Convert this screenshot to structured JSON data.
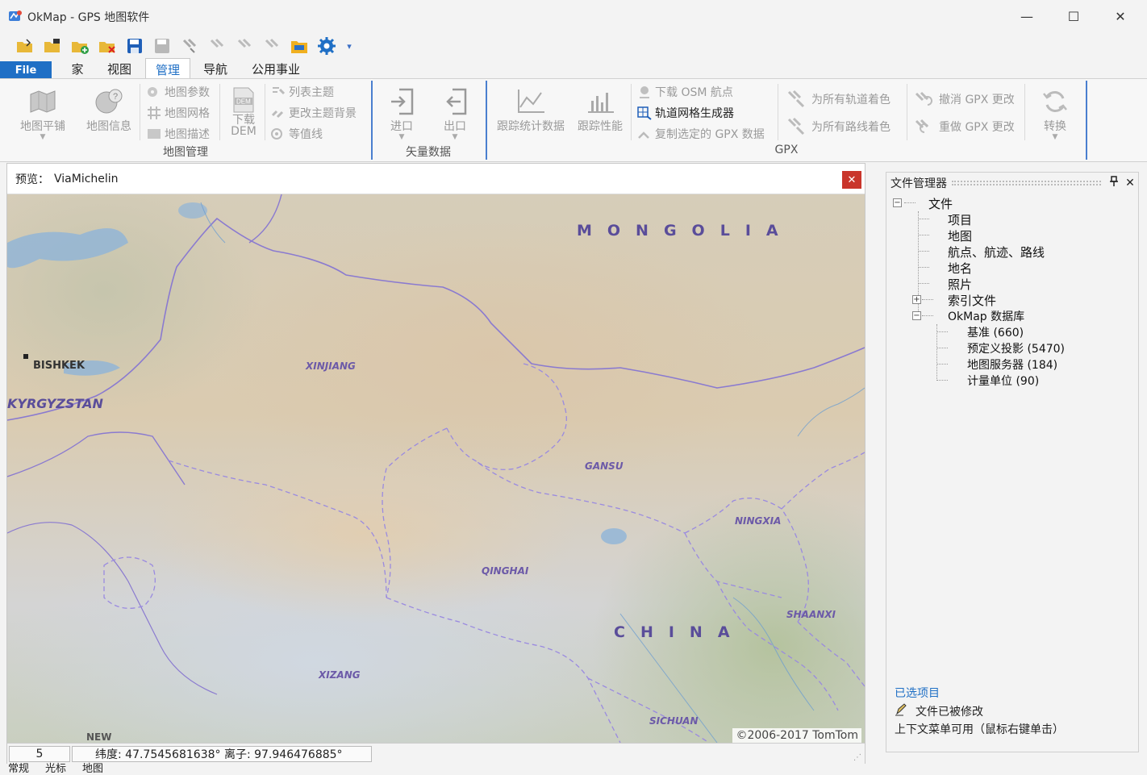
{
  "window": {
    "title": "OkMap - GPS 地图软件",
    "minimize": "—",
    "maximize": "☐",
    "close": "✕"
  },
  "qat": {
    "icons": [
      "open-folder-icon",
      "open-folder-icon",
      "add-folder-icon",
      "close-folder-icon",
      "save-icon",
      "save-disabled-icon",
      "download-disabled-icon",
      "upload-disabled-icon",
      "export-disabled-icon",
      "import-disabled-icon",
      "folder-icon",
      "settings-icon"
    ],
    "more": "▾"
  },
  "tabs": {
    "file": "File",
    "home": "家",
    "view": "视图",
    "manage": "管理",
    "navigate": "导航",
    "utilities": "公用事业"
  },
  "ribbon": {
    "map_tile": "地图平铺",
    "map_info": "地图信息",
    "map_params": "地图参数",
    "map_grid": "地图网格",
    "map_desc": "地图描述",
    "dem_badge": "DEM",
    "download_dem_1": "下载",
    "download_dem_2": "DEM",
    "list_theme": "列表主题",
    "change_theme_bg": "更改主题背景",
    "contour": "等值线",
    "group_map_manage": "地图管理",
    "import": "进口",
    "export": "出口",
    "group_vector": "矢量数据",
    "track_stats": "跟踪统计数据",
    "track_perf": "跟踪性能",
    "download_osm": "下载 OSM 航点",
    "track_grid": "轨道网格生成器",
    "copy_gpx": "复制选定的 GPX 数据",
    "color_tracks": "为所有轨道着色",
    "color_routes": "为所有路线着色",
    "undo_gpx": "撤消 GPX 更改",
    "redo_gpx": "重做 GPX 更改",
    "convert": "转换",
    "group_gpx": "GPX"
  },
  "preview": {
    "label": "预览：",
    "source": "ViaMichelin",
    "close": "✕",
    "copyright": "©2006-2017 TomTom"
  },
  "map_labels": {
    "mongolia": "MONGOLIA",
    "china": "CHINA",
    "bishkek": "BISHKEK",
    "kyrgyzstan": "KYRGYZSTAN",
    "xinjiang": "XINJIANG",
    "gansu": "GANSU",
    "ningxia": "NINGXIA",
    "qinghai": "QINGHAI",
    "shaanxi": "SHAANXI",
    "xizang": "XIZANG",
    "sichuan": "SICHUAN",
    "new": "NEW"
  },
  "statusbar": {
    "zoom": "5",
    "coords": "纬度: 47.7545681638°  离子: 97.946476885°"
  },
  "bottom_tabs": [
    "常规",
    "光标",
    "地图"
  ],
  "file_manager": {
    "title": "文件管理器",
    "pin": "📌",
    "close": "✕",
    "root": "文件",
    "items": [
      "项目",
      "地图",
      "航点、航迹、路线",
      "地名",
      "照片",
      "索引文件",
      "OkMap 数据库"
    ],
    "db_items": [
      "基准 (660)",
      "预定义投影 (5470)",
      "地图服务器 (184)",
      "计量单位 (90)"
    ],
    "selected_project": "已选项目",
    "file_modified": "文件已被修改",
    "context_menu": "上下文菜单可用（鼠标右键单击）"
  },
  "colors": {
    "accent": "#1f6fc5",
    "close_red": "#c9352b",
    "border_purple": "#8a7ad0"
  }
}
